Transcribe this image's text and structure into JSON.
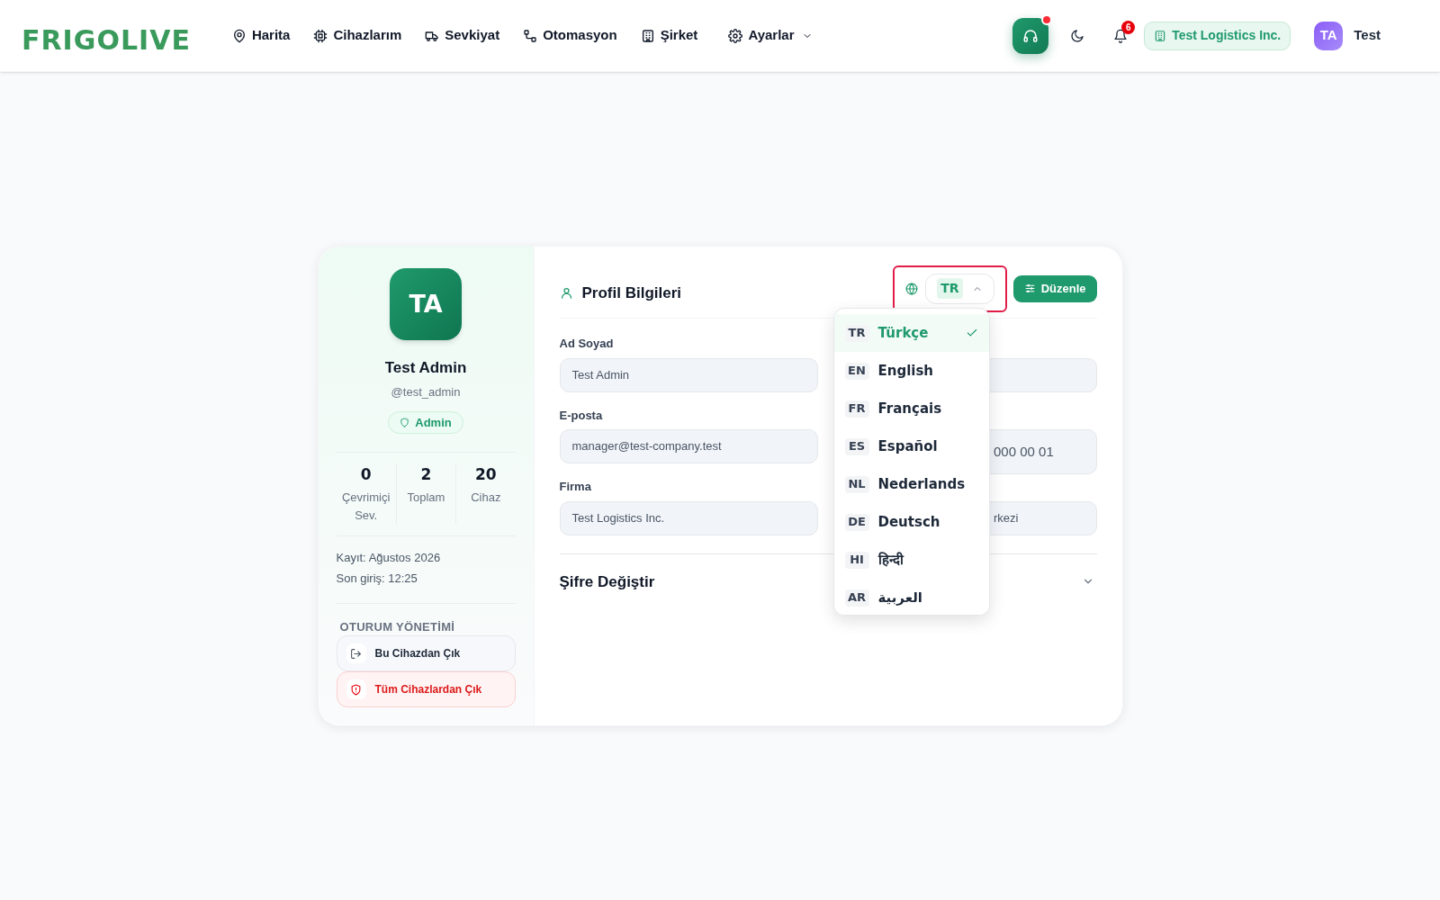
{
  "header": {
    "logo": "FRIGOLIVE",
    "nav": [
      {
        "label": "Harita",
        "dropdown": false
      },
      {
        "label": "Cihazlarım",
        "dropdown": false
      },
      {
        "label": "Sevkiyat",
        "dropdown": false
      },
      {
        "label": "Otomasyon",
        "dropdown": false
      },
      {
        "label": "Şirket",
        "dropdown": false
      },
      {
        "label": "Ayarlar",
        "dropdown": true
      }
    ],
    "support_unread": true,
    "notification_count": "6",
    "company": "Test Logistics Inc.",
    "user": {
      "initials": "TA",
      "name": "Test"
    }
  },
  "profile": {
    "initials": "TA",
    "name": "Test Admin",
    "username": "@test_admin",
    "role": "Admin",
    "stats": [
      {
        "value": "0",
        "label": "Çevrimiçi Sev."
      },
      {
        "value": "2",
        "label": "Toplam"
      },
      {
        "value": "20",
        "label": "Cihaz"
      }
    ],
    "meta": [
      "Kayıt: Ağustos 2026",
      "Son giriş: 12:25"
    ],
    "session_title": "OTURUM YÖNETİMİ",
    "session_buttons": [
      {
        "label": "Bu Cihazdan Çık",
        "kind": "normal"
      },
      {
        "label": "Tüm Cihazlardan Çık",
        "kind": "danger"
      }
    ]
  },
  "form": {
    "title": "Profil Bilgileri",
    "language": {
      "code": "TR",
      "expanded": true
    },
    "edit_button": "Düzenle",
    "rows": [
      {
        "label": "Ad Soyad",
        "value": "Test Admin",
        "right": {}
      },
      {
        "label": "E-posta",
        "value": "manager@test-company.test",
        "right": {
          "value": "000 00 01"
        }
      },
      {
        "label": "Firma",
        "value": "Test Logistics Inc.",
        "right": {
          "value": "rkezi"
        }
      }
    ],
    "password_section": {
      "title": "Şifre Değiştir",
      "expanded": false
    },
    "languages": [
      {
        "code": "TR",
        "name": "Türkçe",
        "selected": true
      },
      {
        "code": "EN",
        "name": "English",
        "selected": false
      },
      {
        "code": "FR",
        "name": "Français",
        "selected": false
      },
      {
        "code": "ES",
        "name": "Español",
        "selected": false
      },
      {
        "code": "NL",
        "name": "Nederlands",
        "selected": false
      },
      {
        "code": "DE",
        "name": "Deutsch",
        "selected": false
      },
      {
        "code": "HI",
        "name": "हिन्दी",
        "selected": false
      },
      {
        "code": "AR",
        "name": "العربية",
        "selected": false
      }
    ]
  }
}
